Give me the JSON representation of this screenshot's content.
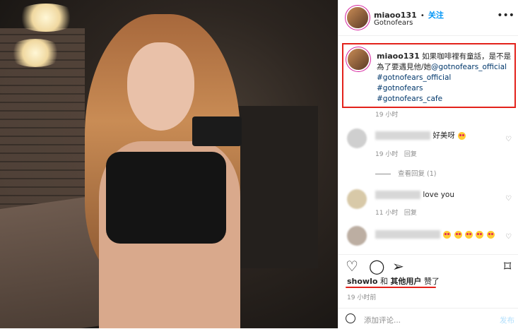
{
  "post": {
    "username": "miaoo131",
    "separator": "•",
    "follow_label": "关注",
    "location": "Gotnofears",
    "more_icon": "more-horizontal-icon"
  },
  "caption": {
    "username": "miaoo131",
    "text": "如果咖啡裡有童話，是不是為了要遇見他/她",
    "mention": "@gotnofears_official",
    "tags": [
      "#gotnofears_official",
      "#gotnofears",
      "#gotnofears_cafe"
    ],
    "time": "19 小时"
  },
  "comments": [
    {
      "text": "好美呀",
      "emoji_count": 1,
      "time": "19 小时",
      "reply_label": "回复"
    },
    {
      "text": "love you",
      "emoji_count": 0,
      "time": "11 小时",
      "reply_label": "回复"
    },
    {
      "text": "",
      "emoji_count": 5
    }
  ],
  "view_replies": "查看回复 (1)",
  "likes": {
    "user": "showlo",
    "and": "和",
    "others": "其他用户",
    "suffix": "赞了",
    "time": "19 小时前"
  },
  "add_comment": {
    "placeholder": "添加评论...",
    "post_label": "发布"
  },
  "colors": {
    "accent": "#0095f6",
    "highlight": "#e3221b",
    "link": "#00376b"
  }
}
